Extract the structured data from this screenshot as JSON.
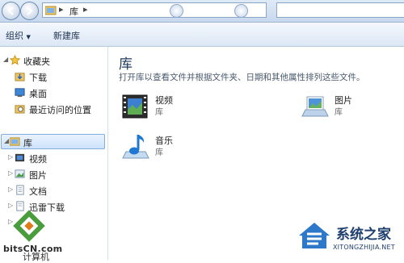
{
  "address_bar": {
    "path": "库",
    "separator": "▸"
  },
  "toolbar": {
    "organize_label": "组织",
    "organize_arrow": "▼",
    "new_library_label": "新建库"
  },
  "nav": {
    "favorites": {
      "label": "收藏夹",
      "items": [
        {
          "label": "下载",
          "icon": "download-folder-icon"
        },
        {
          "label": "桌面",
          "icon": "desktop-icon"
        },
        {
          "label": "最近访问的位置",
          "icon": "recent-places-icon"
        }
      ]
    },
    "library": {
      "label": "库",
      "items": [
        {
          "label": "视频",
          "icon": "video-library-icon"
        },
        {
          "label": "图片",
          "icon": "pictures-library-icon"
        },
        {
          "label": "文档",
          "icon": "documents-library-icon"
        },
        {
          "label": "迅雷下载",
          "icon": "xunlei-download-icon"
        }
      ]
    },
    "computer_partial": "计算机"
  },
  "main": {
    "title": "库",
    "description": "打开库以查看文件并根据文件夹、日期和其他属性排列这些文件。",
    "libraries": [
      {
        "name": "视频",
        "kind": "库",
        "icon": "video-library-icon"
      },
      {
        "name": "图片",
        "kind": "库",
        "icon": "pictures-library-icon"
      },
      {
        "name": "音乐",
        "kind": "库",
        "icon": "music-library-icon"
      }
    ]
  },
  "watermarks": {
    "left_text": "bitsCN.com",
    "right_title": "系统之家",
    "right_url": "XITONGZHIJIA.NET"
  },
  "colors": {
    "accent": "#1e395b",
    "selection": "#cde2fb",
    "toolbar_bg": "#dce7f5"
  }
}
